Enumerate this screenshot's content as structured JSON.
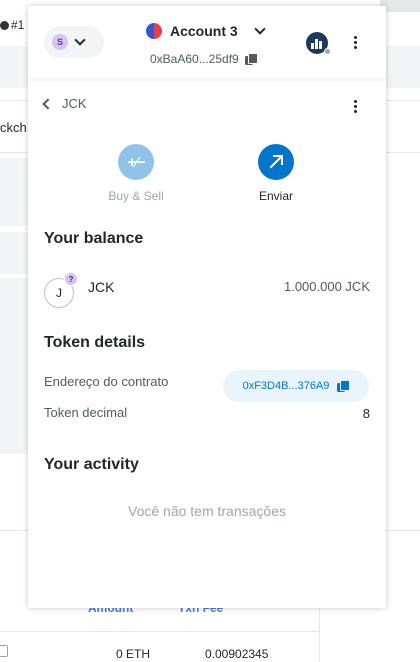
{
  "background": {
    "tab_label": "#1",
    "partial_text": "ckch",
    "table": {
      "headers": [
        "Amount",
        "Txn Fee"
      ],
      "row": [
        "0 ETH",
        "0.00902345"
      ]
    }
  },
  "header": {
    "network_initial": "S",
    "account_name": "Account 3",
    "address": "0xBaA60...25df9"
  },
  "token_page": {
    "back_label": "JCK",
    "actions": {
      "buy_sell": "Buy & Sell",
      "send": "Enviar"
    },
    "balance": {
      "title": "Your balance",
      "token_initial": "J",
      "badge": "?",
      "symbol": "JCK",
      "amount": "1.000.000 JCK"
    },
    "details": {
      "title": "Token details",
      "contract_label": "Endereço do contrato",
      "contract_address": "0xF3D4B...376A9",
      "decimal_label": "Token decimal",
      "decimal_value": "8"
    },
    "activity": {
      "title": "Your activity",
      "empty": "Você não tem transações"
    }
  },
  "colors": {
    "primary": "#0376c9",
    "primary_muted": "#8fc3ea",
    "text": "#24272a",
    "text_muted": "#9fa6ae"
  }
}
